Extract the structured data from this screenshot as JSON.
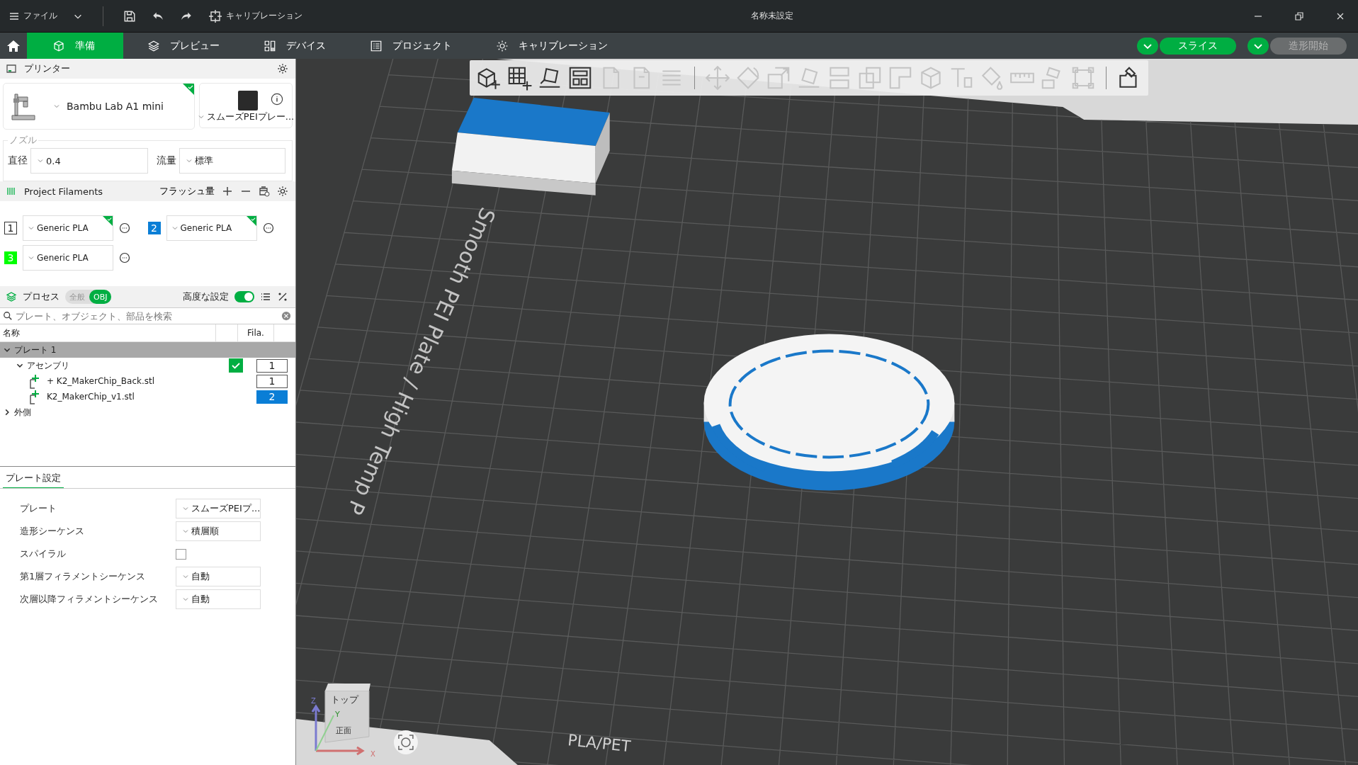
{
  "title_bar": {
    "menu_label": "ファイル",
    "calibration_label": "キャリブレーション",
    "title": "名称未設定"
  },
  "tabs": [
    {
      "label": "準備",
      "selected": true
    },
    {
      "label": "プレビュー",
      "selected": false
    },
    {
      "label": "デバイス",
      "selected": false
    },
    {
      "label": "プロジェクト",
      "selected": false
    },
    {
      "label": "キャリブレーション",
      "selected": false
    }
  ],
  "actions": [
    {
      "label": "スライス",
      "disabled": false
    },
    {
      "label": "造形開始",
      "disabled": true
    }
  ],
  "printer": {
    "header": "プリンター",
    "model": "Bambu Lab A1 mini",
    "synced": true,
    "plate": "スムーズPEIプレー...",
    "nozzle_legend": "ノズル",
    "diameter_label": "直径",
    "diameter": "0.4",
    "flow_label": "流量",
    "flow": "標準"
  },
  "filaments": {
    "header": "Project Filaments",
    "flush_button": "フラッシュ量",
    "items": [
      {
        "number": "1",
        "color": "#ffffff",
        "name": "Generic PLA",
        "synced": true
      },
      {
        "number": "2",
        "color": "#0a7ed6",
        "name": "Generic PLA",
        "synced": true
      },
      {
        "number": "3",
        "color": "#00ff00",
        "name": "Generic PLA",
        "synced": false
      }
    ]
  },
  "process": {
    "header": "プロセス",
    "modes": [
      {
        "label": "全般",
        "selected": false
      },
      {
        "label": "OBJ",
        "selected": true
      }
    ],
    "advanced_label": "高度な設定",
    "advanced_on": true,
    "search_placeholder": "プレート、オブジェクト、部品を検索"
  },
  "object_list": {
    "name_header": "名称",
    "fila_header": "Fila.",
    "tree": [
      {
        "name": "プレート 1",
        "expanded": true,
        "selected": true,
        "children": [
          {
            "name": "アセンブリ",
            "expanded": true,
            "checked": true,
            "fila": "1",
            "color": "#ffffff",
            "children": [
              {
                "name": "+ K2_MakerChip_Back.stl",
                "fila": "1",
                "color": "#ffffff"
              },
              {
                "name": "K2_MakerChip_v1.stl",
                "fila": "2",
                "color": "#0a7ed6"
              }
            ]
          }
        ]
      },
      {
        "name": "外側",
        "expanded": false,
        "selected": false
      }
    ]
  },
  "plate_settings": {
    "tab": "プレート設定",
    "rows": [
      {
        "kind": "select",
        "label": "プレート",
        "value": "スムーズPEIプ..."
      },
      {
        "kind": "select",
        "label": "造形シーケンス",
        "value": "積層順"
      },
      {
        "kind": "checkbox",
        "label": "スパイラル",
        "checked": false
      },
      {
        "kind": "select",
        "label": "第1層フィラメントシーケンス",
        "value": "自動"
      },
      {
        "kind": "select",
        "label": "次層以降フィラメントシーケンス",
        "value": "自動"
      }
    ]
  },
  "viewport": {
    "toolbar": [
      {
        "kind": "tool",
        "disabled": false
      },
      {
        "kind": "tool",
        "disabled": false
      },
      {
        "kind": "tool",
        "disabled": false
      },
      {
        "kind": "tool",
        "disabled": false
      },
      {
        "kind": "tool",
        "disabled": true
      },
      {
        "kind": "tool",
        "disabled": true
      },
      {
        "kind": "tool",
        "disabled": true
      },
      {
        "kind": "separator"
      },
      {
        "kind": "tool",
        "disabled": true
      },
      {
        "kind": "tool",
        "disabled": true
      },
      {
        "kind": "tool",
        "disabled": true
      },
      {
        "kind": "tool",
        "disabled": true
      },
      {
        "kind": "tool",
        "disabled": true
      },
      {
        "kind": "tool",
        "disabled": true
      },
      {
        "kind": "tool",
        "disabled": true
      },
      {
        "kind": "tool",
        "disabled": true
      },
      {
        "kind": "tool",
        "disabled": true
      },
      {
        "kind": "tool",
        "disabled": true
      },
      {
        "kind": "tool",
        "disabled": true
      },
      {
        "kind": "tool",
        "disabled": true
      },
      {
        "kind": "tool",
        "disabled": true
      },
      {
        "kind": "separator"
      },
      {
        "kind": "tool",
        "disabled": false
      }
    ],
    "bed_label": "Smooth PEI Plate / High Temp P",
    "bed_label_bottom": "PLA/PET",
    "cube_top": "トップ",
    "cube_front": "正面",
    "axis_z": "Z",
    "axis_y": "Y",
    "axis_x": "X"
  }
}
